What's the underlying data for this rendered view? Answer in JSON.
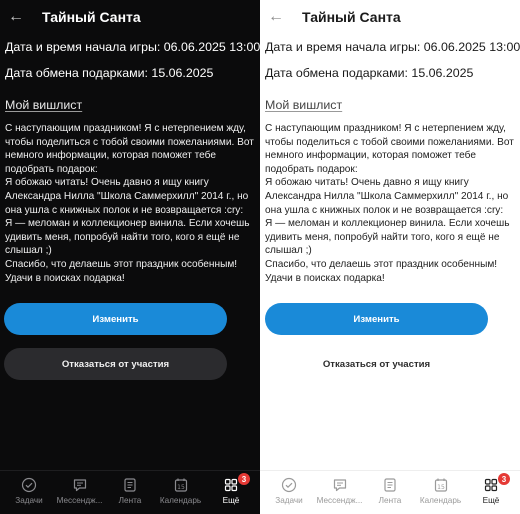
{
  "header": {
    "title": "Тайный Санта"
  },
  "game": {
    "start_line": "Дата и время начала игры: 06.06.2025 13:00",
    "exchange_line": "Дата обмена подарками: 15.06.2025"
  },
  "wishlist": {
    "title": "Мой вишлист",
    "text": "С наступающим праздником! Я с нетерпением жду, чтобы поделиться с тобой своими пожеланиями. Вот немного информации, которая поможет тебе подобрать подарок:\nЯ обожаю читать! Очень давно я ищу книгу Александра Нилла \"Школа Саммерхилл\" 2014 г., но она ушла с книжных полок и не возвращается :cry:\nЯ — меломан и коллекционер винила. Если хочешь удивить меня, попробуй найти того, кого я ещё не слышал ;)\nСпасибо, что делаешь этот праздник особенным! Удачи в поисках подарка!"
  },
  "buttons": {
    "edit": "Изменить",
    "decline": "Отказаться от участия"
  },
  "tabs": [
    {
      "label": "Задачи",
      "icon": "check-circle-icon"
    },
    {
      "label": "Мессендж...",
      "icon": "chat-icon"
    },
    {
      "label": "Лента",
      "icon": "feed-icon"
    },
    {
      "label": "Календарь",
      "icon": "calendar-icon",
      "calendar_day": "15"
    },
    {
      "label": "Ещё",
      "icon": "grid-icon",
      "badge": "3"
    }
  ],
  "colors": {
    "accent": "#1a8ad8",
    "badge": "#e53935",
    "dark_background": "#0b0b0c",
    "light_background": "#ffffff"
  }
}
